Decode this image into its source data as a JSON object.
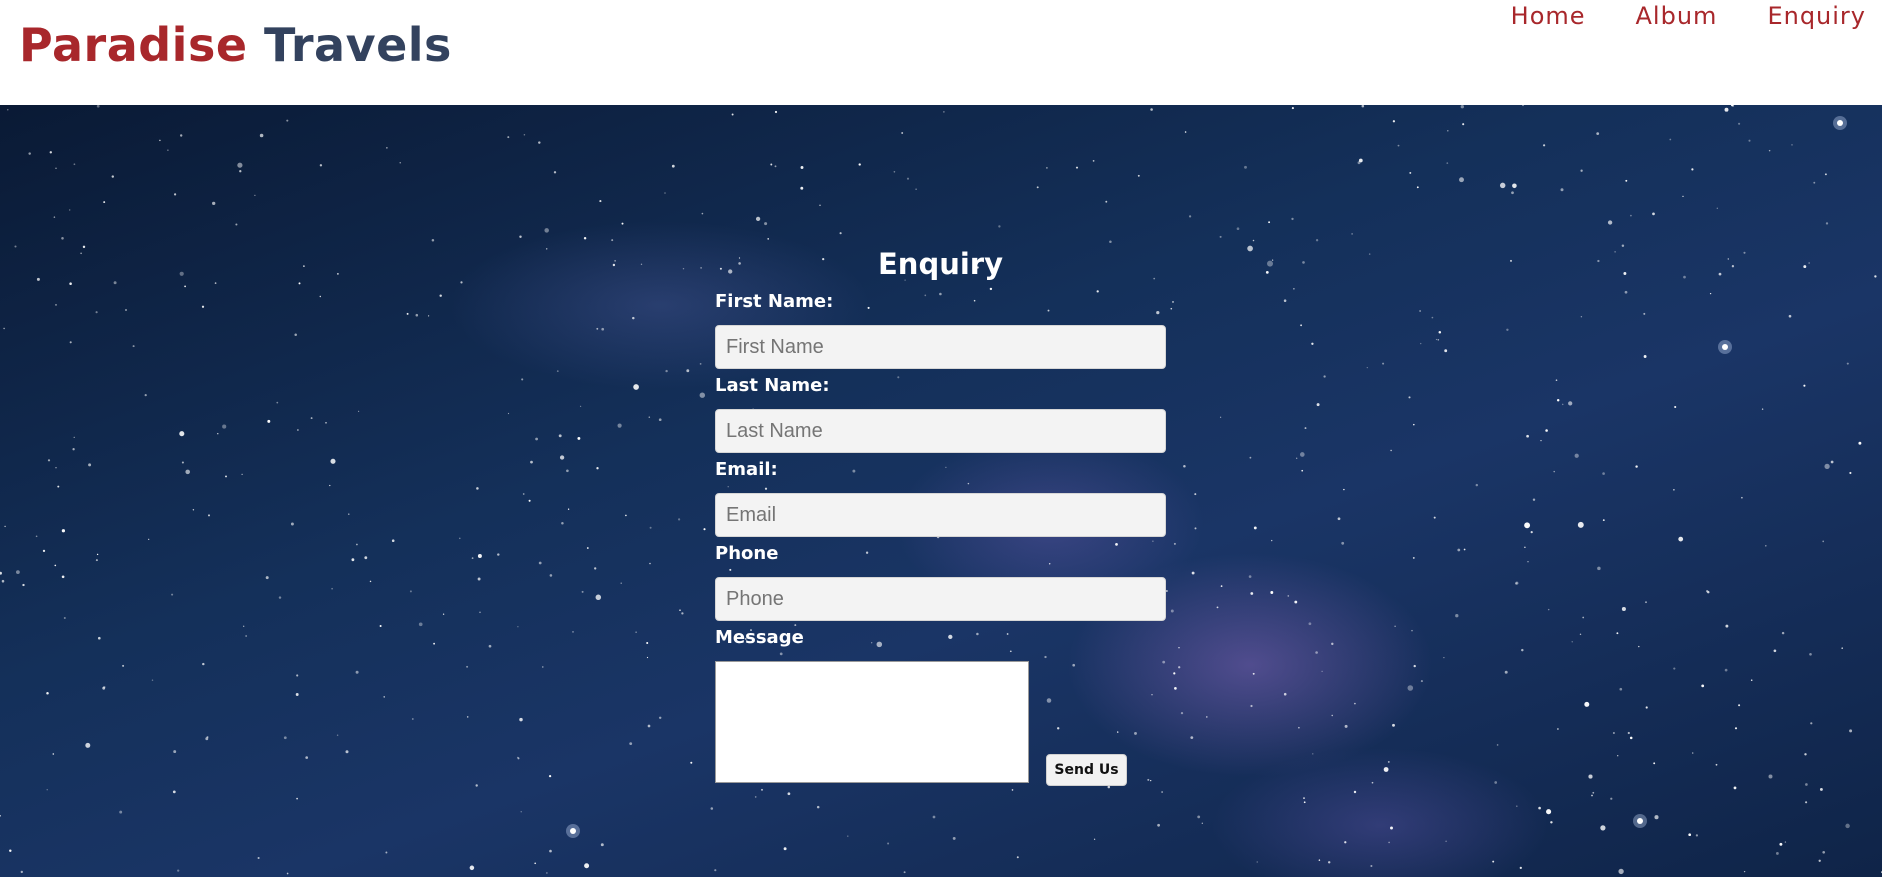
{
  "header": {
    "brand_part1": "Paradise",
    "brand_part2": "Travels",
    "nav": [
      {
        "label": "Home"
      },
      {
        "label": "Album"
      },
      {
        "label": "Enquiry"
      }
    ]
  },
  "form": {
    "title": "Enquiry",
    "first_name_label": "First Name:",
    "first_name_placeholder": "First Name",
    "last_name_label": "Last Name:",
    "last_name_placeholder": "Last Name",
    "email_label": "Email:",
    "email_placeholder": "Email",
    "phone_label": "Phone",
    "phone_placeholder": "Phone",
    "message_label": "Message",
    "submit_label": "Send Us"
  },
  "colors": {
    "brand_red": "#a8272b",
    "brand_navy": "#33425e"
  }
}
